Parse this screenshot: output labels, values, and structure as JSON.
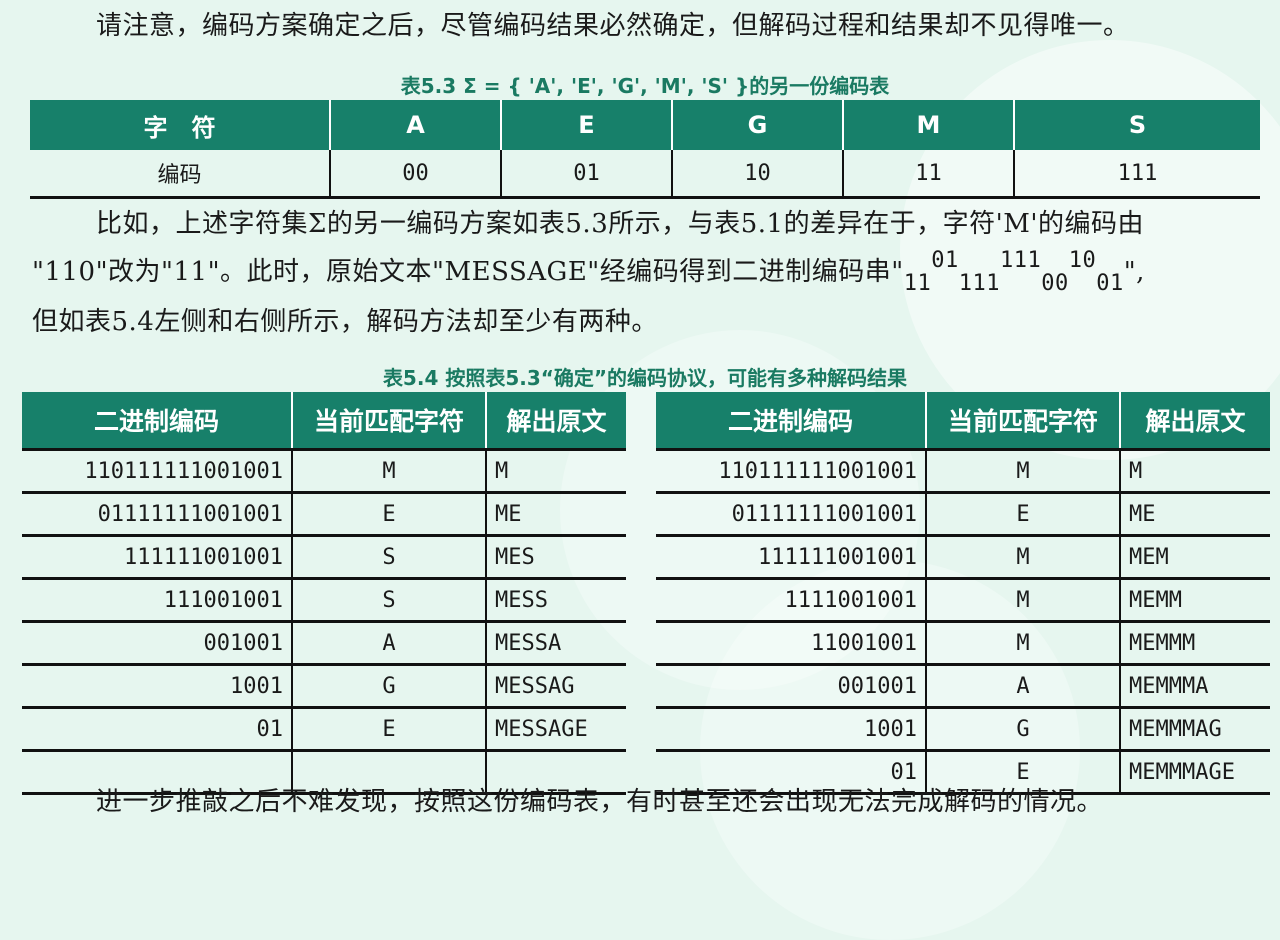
{
  "intro_text": "请注意，编码方案确定之后，尽管编码结果必然确定，但解码过程和结果却不见得唯一。",
  "table53": {
    "caption": "表5.3 Σ = { 'A', 'E', 'G', 'M', 'S' }的另一份编码表",
    "header_label": "字　符",
    "chars": [
      "A",
      "E",
      "G",
      "M",
      "S"
    ],
    "row_label": "编码",
    "codes": [
      "00",
      "01",
      "10",
      "11",
      "111"
    ]
  },
  "para2": {
    "line1": "比如，上述字符集Σ的另一编码方案如表5.3所示，与表5.1的差异在于，字符'M'的编码由",
    "line2_a": "\"110\"改为\"11\"。此时，原始文本\"MESSAGE\"经编码得到二进制编码串\"",
    "enc_parts": [
      "11",
      "01",
      "111",
      "111",
      "00",
      "10",
      "01"
    ],
    "line2_close": "\",",
    "line3": "但如表5.4左侧和右侧所示，解码方法却至少有两种。"
  },
  "table54": {
    "caption": "表5.4 按照表5.3“确定”的编码协议，可能有多种解码结果",
    "headers": [
      "二进制编码",
      "当前匹配字符",
      "解出原文"
    ],
    "left_rows": [
      [
        "110111111001001",
        "M",
        "M"
      ],
      [
        "01111111001001",
        "E",
        "ME"
      ],
      [
        "111111001001",
        "S",
        "MES"
      ],
      [
        "111001001",
        "S",
        "MESS"
      ],
      [
        "001001",
        "A",
        "MESSA"
      ],
      [
        "1001",
        "G",
        "MESSAG"
      ],
      [
        "01",
        "E",
        "MESSAGE"
      ],
      [
        "",
        "",
        ""
      ]
    ],
    "right_rows": [
      [
        "110111111001001",
        "M",
        "M"
      ],
      [
        "01111111001001",
        "E",
        "ME"
      ],
      [
        "111111001001",
        "M",
        "MEM"
      ],
      [
        "1111001001",
        "M",
        "MEMM"
      ],
      [
        "11001001",
        "M",
        "MEMMM"
      ],
      [
        "001001",
        "A",
        "MEMMMA"
      ],
      [
        "1001",
        "G",
        "MEMMMAG"
      ],
      [
        "01",
        "E",
        "MEMMMAGE"
      ]
    ]
  },
  "outro_text": "进一步推敲之后不难发现，按照这份编码表，有时甚至还会出现无法完成解码的情况。"
}
